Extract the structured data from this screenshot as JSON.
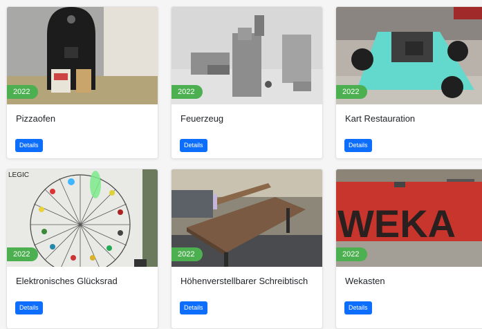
{
  "cards": [
    {
      "title": "Pizzaofen",
      "year": "2022",
      "button": "Details"
    },
    {
      "title": "Feuerzeug",
      "year": "2022",
      "button": "Details"
    },
    {
      "title": "Kart Restauration",
      "year": "2022",
      "button": "Details"
    },
    {
      "title": "Elektronisches Glücksrad",
      "year": "2022",
      "button": "Details"
    },
    {
      "title": "Höhenverstellbarer Schreibtisch",
      "year": "2022",
      "button": "Details"
    },
    {
      "title": "Wekasten",
      "year": "2022",
      "button": "Details"
    }
  ],
  "images": {
    "wheel_logo": "LEGIC",
    "sign_text": "WEKA"
  },
  "colors": {
    "accent": "#0d6efd",
    "badge": "#4caf50"
  }
}
